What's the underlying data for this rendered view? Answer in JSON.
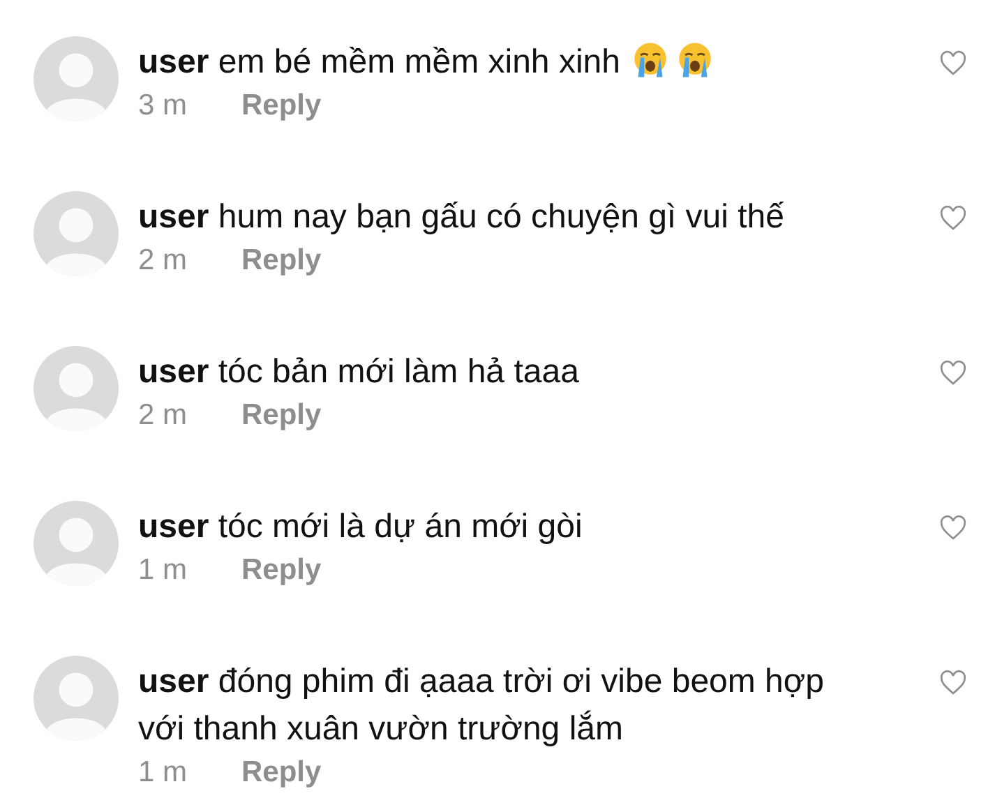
{
  "comments": [
    {
      "user": "user",
      "text": "em bé mềm mềm xinh xinh",
      "emojis": [
        {
          "kind": "crying-face"
        },
        {
          "kind": "crying-face"
        }
      ],
      "time": "3 m",
      "reply": "Reply",
      "liked": false
    },
    {
      "user": "user",
      "text": "hum nay bạn gấu có chuyện gì vui thế",
      "time": "2 m",
      "reply": "Reply",
      "liked": false
    },
    {
      "user": "user",
      "text": "tóc bản mới làm hả taaa",
      "time": "2 m",
      "reply": "Reply",
      "liked": false
    },
    {
      "user": "user",
      "text": "tóc mới là dự án mới gòi",
      "time": "1 m",
      "reply": "Reply",
      "liked": false
    },
    {
      "user": "user",
      "text": "đóng phim đi ạaaa trời ơi vibe beom hợp với thanh xuân vườn trường lắm",
      "time": "1 m",
      "reply": "Reply",
      "liked": false
    }
  ]
}
